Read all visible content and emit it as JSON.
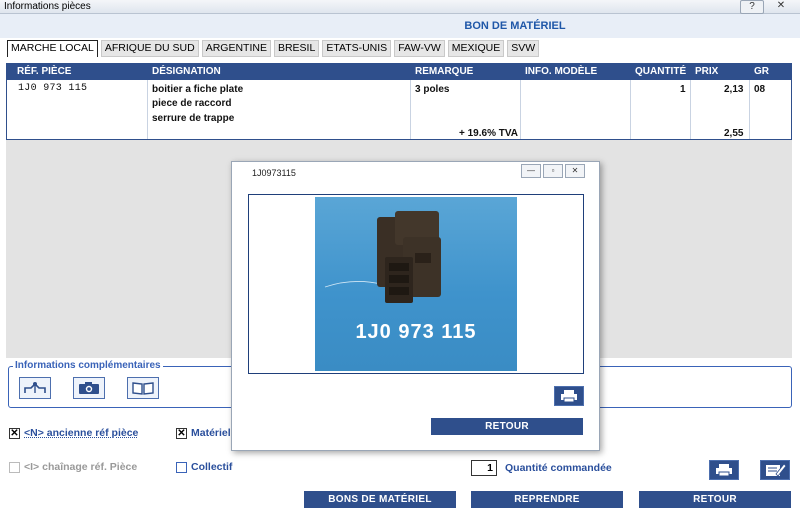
{
  "window": {
    "title": "Informations pièces",
    "help": "?",
    "close": "✕"
  },
  "header": {
    "title": "BON DE MATÉRIEL"
  },
  "tabs": [
    "MARCHE LOCAL",
    "AFRIQUE DU SUD",
    "ARGENTINE",
    "BRESIL",
    "ETATS-UNIS",
    "FAW-VW",
    "MEXIQUE",
    "SVW"
  ],
  "table": {
    "headers": {
      "ref": "RÉF. PIÈCE",
      "designation": "DÉSIGNATION",
      "remarque": "REMARQUE",
      "info_modele": "INFO. MODÈLE",
      "quantite": "QUANTITÉ",
      "prix": "PRIX",
      "gr": "GR"
    },
    "row": {
      "ref": "1J0 973 115",
      "designation_1": "boitier a fiche plate",
      "designation_2": "piece de raccord",
      "designation_3": "serrure de trappe",
      "remarque": "3 poles",
      "quantite": "1",
      "prix": "2,13",
      "gr": "08",
      "tva_label": "+ 19.6% TVA",
      "prix_ttc": "2,55"
    }
  },
  "info_complementaires": {
    "label": "Informations complémentaires"
  },
  "options": {
    "ancienne_ref": "<N> ancienne réf pièce",
    "materiel": "Matériel",
    "chainage": "<I> chaînage réf. Pièce",
    "collectif": "Collectif",
    "quantite_value": "1",
    "quantite_label": "Quantité commandée"
  },
  "buttons": {
    "bons": "BONS DE MATÉRIEL",
    "reprendre": "REPRENDRE",
    "retour": "RETOUR"
  },
  "popup": {
    "title": "1J0973115",
    "image_caption": "1J0 973 115",
    "retour": "RETOUR",
    "min": "—",
    "max": "▫",
    "close": "✕"
  },
  "colors": {
    "accent": "#2f4f8c",
    "header_text": "#1f57a8",
    "photo_bg": "#4a9cd2"
  }
}
